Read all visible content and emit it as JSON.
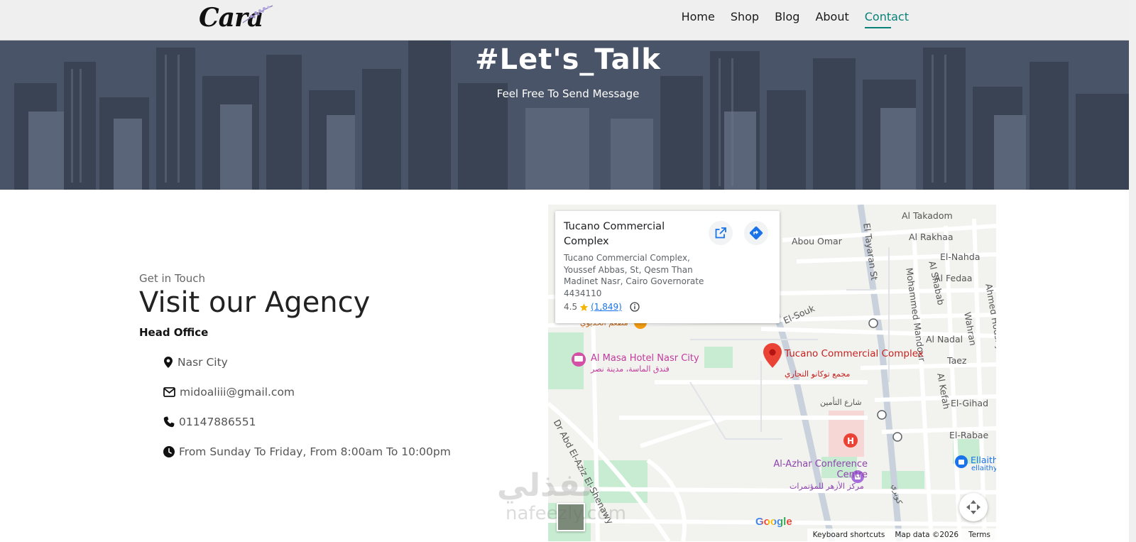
{
  "header": {
    "logo_text": "Cara",
    "nav": [
      {
        "label": "Home",
        "active": false
      },
      {
        "label": "Shop",
        "active": false
      },
      {
        "label": "Blog",
        "active": false
      },
      {
        "label": "About",
        "active": false
      },
      {
        "label": "Contact",
        "active": true
      }
    ],
    "accent_color": "#088178"
  },
  "hero": {
    "title": "#Let's_Talk",
    "subtitle": "Feel Free To Send Message"
  },
  "contact": {
    "kicker": "Get in Touch",
    "title": "Visit our Agency",
    "section": "Head Office",
    "items": [
      {
        "icon": "map-marker-icon",
        "text": "Nasr City"
      },
      {
        "icon": "envelope-icon",
        "text": "midoaliii@gmail.com"
      },
      {
        "icon": "phone-icon",
        "text": "01147886551"
      },
      {
        "icon": "clock-icon",
        "text": "From Sunday To Friday, From 8:00am To 10:00pm"
      }
    ]
  },
  "map": {
    "card": {
      "title": "Tucano Commercial Complex",
      "address": "Tucano Commercial Complex, Youssef Abbas, St, Qesm Than Madinet Nasr, Cairo Governorate 4434110",
      "rating": "4.5",
      "reviews": "(1,849)"
    },
    "labels": {
      "al_takadom": "Al Takadom",
      "al_rakhaa": "Al Rakhaa",
      "abou_omar": "Abou Omar",
      "el_tayaran": "El Tayaran St",
      "el_nahda": "El-Nahda",
      "al_shabab": "Al Shabab",
      "al_fedaa": "Al Fedaa",
      "mohammed_mandour": "Mohammed Mandour",
      "ahmed_housny": "Ahmed Housny",
      "el_souk": "El-Souk",
      "wahran": "Wahran",
      "al_nadal": "Al Nadal",
      "taez": "Taez",
      "al_kefah": "Al Kefah",
      "el_gihad": "El-Gihad",
      "el_rabae": "El-Rabae",
      "ellaith": "Ellaith",
      "ellaithy": "ellaithy",
      "al_masa": "Al Masa Hotel Nasr City",
      "al_masa_ar": "فندق الماسة، مدينة نصر",
      "tucano_pin": "Tucano Commercial Complex",
      "tucano_ar": "مجمع توكانو التجاري",
      "shar_altameen": "شارع التأمين",
      "al_azhar": "Al-Azhar Conference Centre",
      "al_azhar_ar": "مركز الأزهر للمؤتمرات",
      "khedewy_ar": "مطعم الخديوي",
      "dr_abd": "Dr Abd El-Aziz El-Shenawy",
      "kobry_ar": "كوبري"
    },
    "google": "Google",
    "attribution": {
      "shortcuts": "Keyboard shortcuts",
      "mapdata": "Map data ©2026",
      "terms": "Terms"
    }
  },
  "watermark": {
    "ar": "نفذلي",
    "en": "nafeezly.com"
  }
}
